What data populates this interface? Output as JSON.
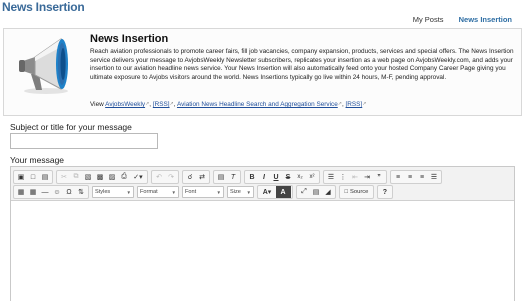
{
  "page": {
    "title": "News Insertion"
  },
  "nav": {
    "my_posts": "My Posts",
    "news_insertion": "News Insertion"
  },
  "header": {
    "title": "News Insertion",
    "description": "Reach aviation professionals to promote career fairs, fill job vacancies, company expansion, products, services and special offers. The News Insertion service delivers your message to AvjobsWeekly Newsletter subscribers, replicates your insertion as a web page on AvjobsWeekly.com, and adds your insertion to our aviation headline news service. Your News Insertion will also automatically feed onto your hosted Company Career Page giving you ultimate exposure to Avjobs visitors around the world. News Insertions typically go live within 24 hours, M-F, pending approval.",
    "view_prefix": "View ",
    "link1": "AvjobsWeekly",
    "rss1": "[RSS]",
    "link2": "Aviation News Headline Search and Aggregation Service",
    "rss2": "[RSS]",
    "comma": ", "
  },
  "form": {
    "subject_label": "Subject or title for your message",
    "subject_value": "",
    "message_label": "Your message"
  },
  "editor": {
    "styles_label": "Styles",
    "format_label": "Format",
    "font_label": "Font",
    "size_label": "Size",
    "source_label": "Source"
  }
}
